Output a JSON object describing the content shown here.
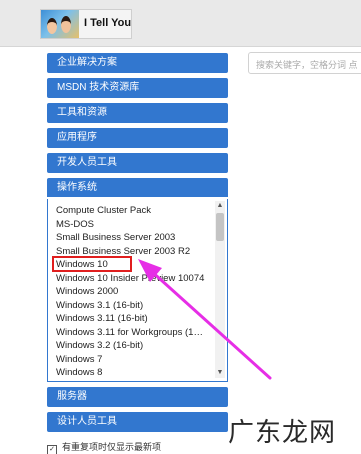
{
  "header": {
    "logo_text": "I Tell You"
  },
  "search": {
    "placeholder": "搜索关键字，空格分词 点"
  },
  "menu": {
    "items": [
      {
        "label": "企业解决方案"
      },
      {
        "label": "MSDN 技术资源库"
      },
      {
        "label": "工具和资源"
      },
      {
        "label": "应用程序"
      },
      {
        "label": "开发人员工具"
      },
      {
        "label": "操作系统"
      }
    ],
    "bottom_items": [
      {
        "label": "服务器"
      },
      {
        "label": "设计人员工具"
      }
    ]
  },
  "os_list": {
    "items": [
      {
        "label": "Compute Cluster Pack"
      },
      {
        "label": "MS-DOS"
      },
      {
        "label": "Small Business Server 2003"
      },
      {
        "label": "Small Business Server 2003 R2"
      },
      {
        "label": "Windows 10"
      },
      {
        "label": "Windows 10 Insider Preview 10074"
      },
      {
        "label": "Windows 2000"
      },
      {
        "label": "Windows 3.1 (16-bit)"
      },
      {
        "label": "Windows 3.11 (16-bit)"
      },
      {
        "label": "Windows 3.11 for Workgroups (1…"
      },
      {
        "label": "Windows 3.2 (16-bit)"
      },
      {
        "label": "Windows 7"
      },
      {
        "label": "Windows 8"
      }
    ],
    "highlighted": "Windows 10"
  },
  "footer": {
    "checkbox_label": "有重复项时仅显示最新项"
  },
  "watermark": {
    "text": "广东龙网"
  },
  "colors": {
    "menu_blue": "#3277cf",
    "highlight_red": "#e01e1e",
    "arrow_magenta": "#e62ee6"
  },
  "icons": {
    "scroll_up": "▲",
    "scroll_down": "▼",
    "checkbox": "✓"
  }
}
